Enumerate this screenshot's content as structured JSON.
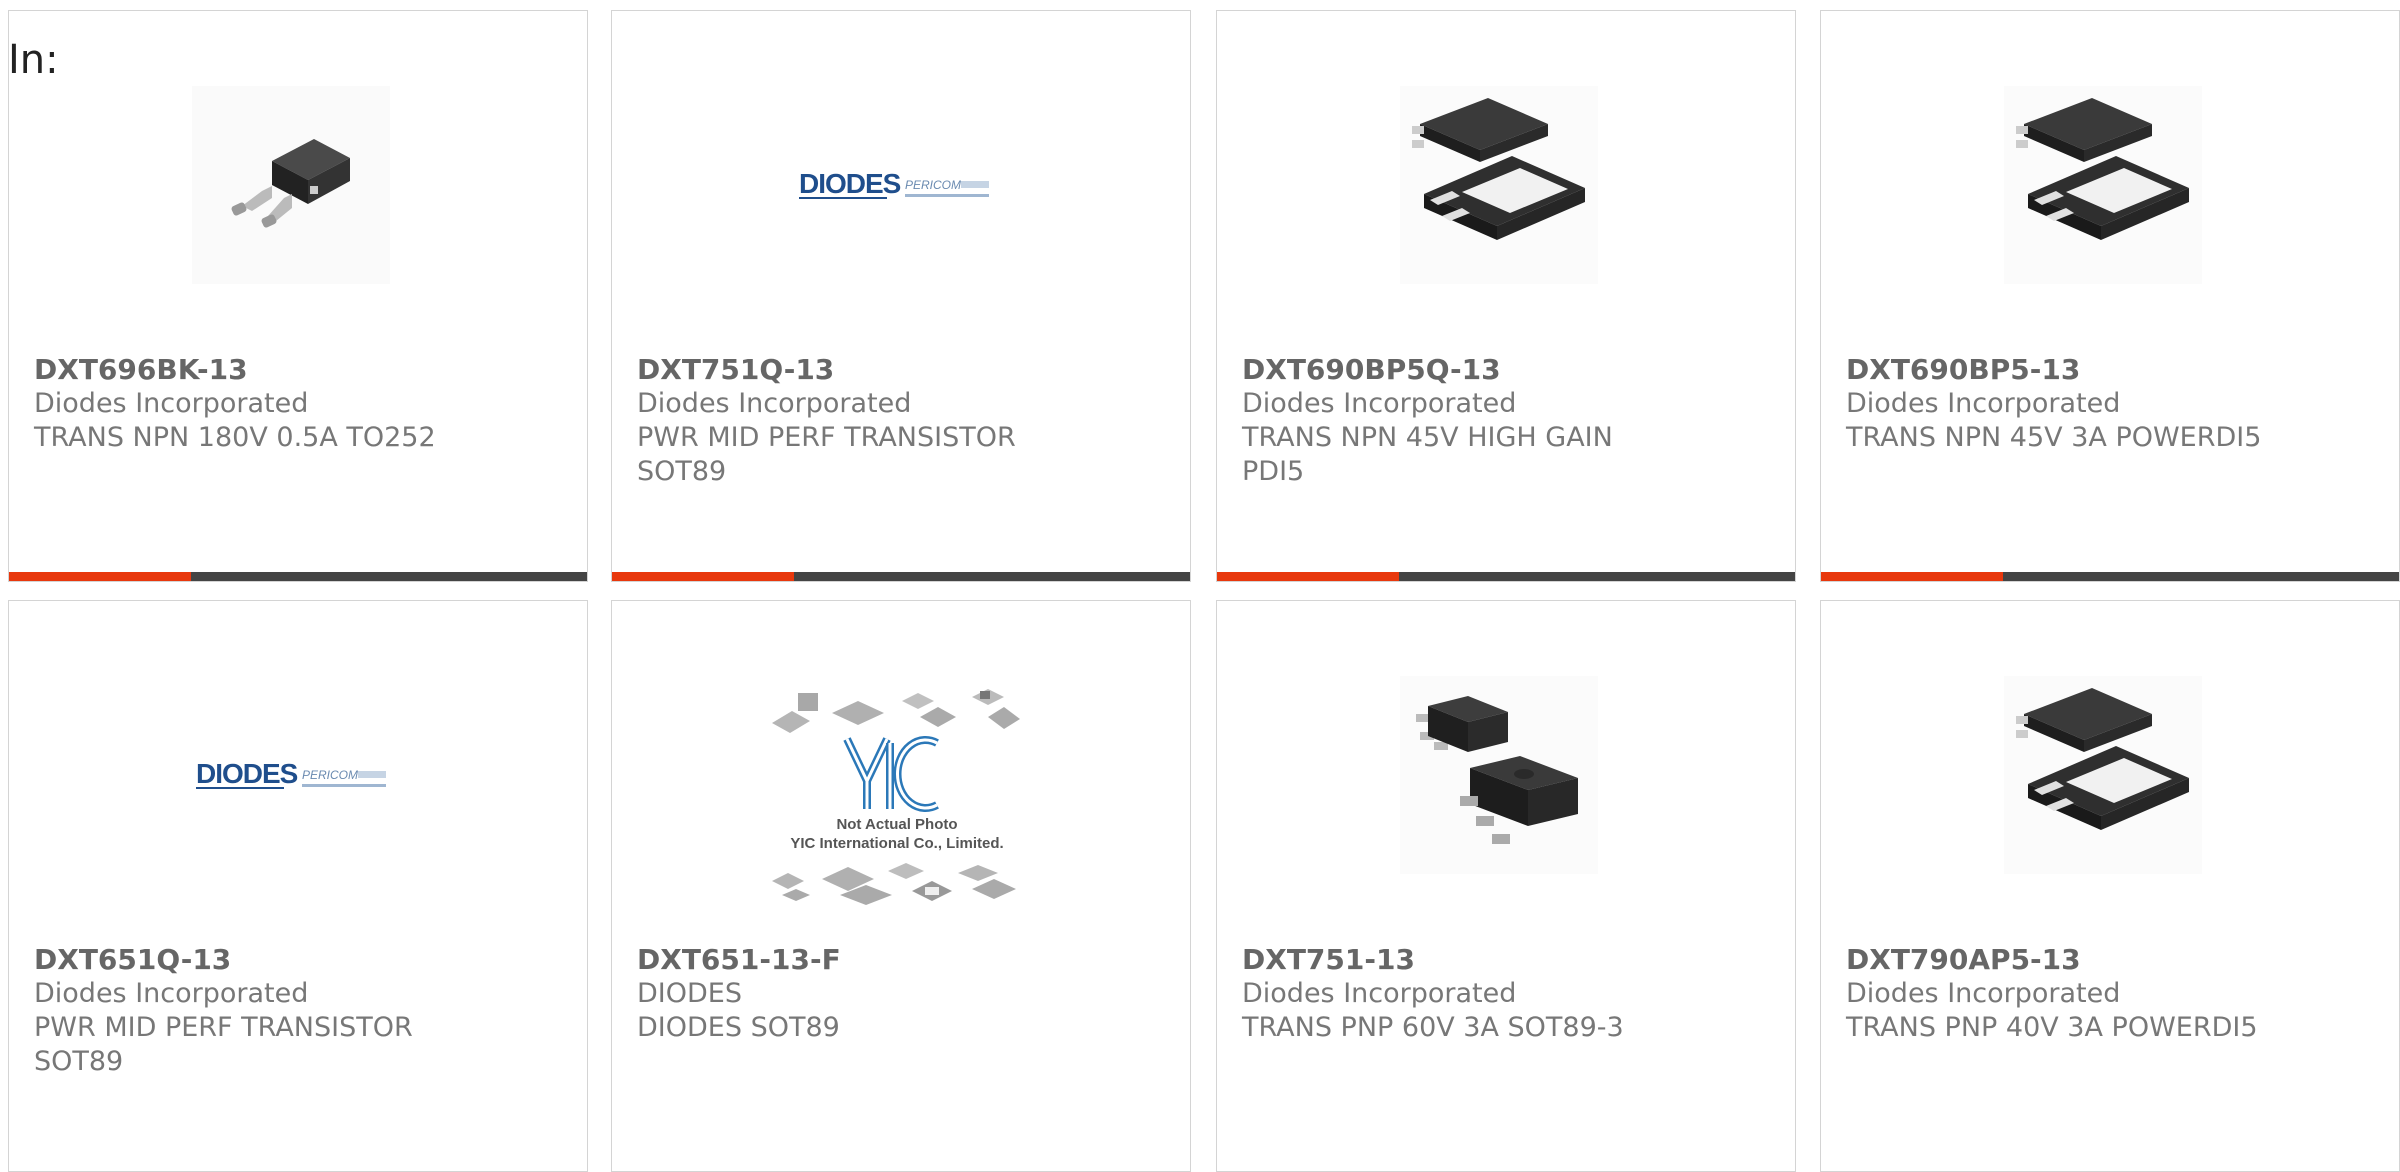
{
  "filter_label": "In:",
  "colors": {
    "accent": "#e8380d",
    "bar": "#444444",
    "text": "#777777",
    "part_number": "#666666",
    "border": "#d4d4d4"
  },
  "products": [
    {
      "part_number": "DXT696BK-13",
      "manufacturer": "Diodes Incorporated",
      "description": "TRANS NPN 180V 0.5A TO252",
      "image": "to252-package-icon"
    },
    {
      "part_number": "DXT751Q-13",
      "manufacturer": "Diodes Incorporated",
      "description": "PWR MID PERF TRANSISTOR SOT89",
      "image": "diodes-pericom-logo"
    },
    {
      "part_number": "DXT690BP5Q-13",
      "manufacturer": "Diodes Incorporated",
      "description": "TRANS NPN 45V HIGH GAIN PDI5",
      "image": "powerdi5-package-icon"
    },
    {
      "part_number": "DXT690BP5-13",
      "manufacturer": "Diodes Incorporated",
      "description": "TRANS NPN 45V 3A POWERDI5",
      "image": "powerdi5-package-icon"
    },
    {
      "part_number": "DXT651Q-13",
      "manufacturer": "Diodes Incorporated",
      "description": "PWR MID PERF TRANSISTOR SOT89",
      "image": "diodes-pericom-logo"
    },
    {
      "part_number": "DXT651-13-F",
      "manufacturer": "DIODES",
      "description": "DIODES SOT89",
      "image": "not-actual-photo-placeholder",
      "placeholder_caption": "Not Actual Photo",
      "placeholder_company": "YIC International Co., Limited."
    },
    {
      "part_number": "DXT751-13",
      "manufacturer": "Diodes Incorporated",
      "description": "TRANS PNP 60V 3A SOT89-3",
      "image": "sot89-package-icon"
    },
    {
      "part_number": "DXT790AP5-13",
      "manufacturer": "Diodes Incorporated",
      "description": "TRANS PNP 40V 3A POWERDI5",
      "image": "powerdi5-package-icon"
    }
  ],
  "logo": {
    "brand": "DIODES",
    "sub": "PERICOM"
  },
  "placeholder_logo_text": "YIC"
}
